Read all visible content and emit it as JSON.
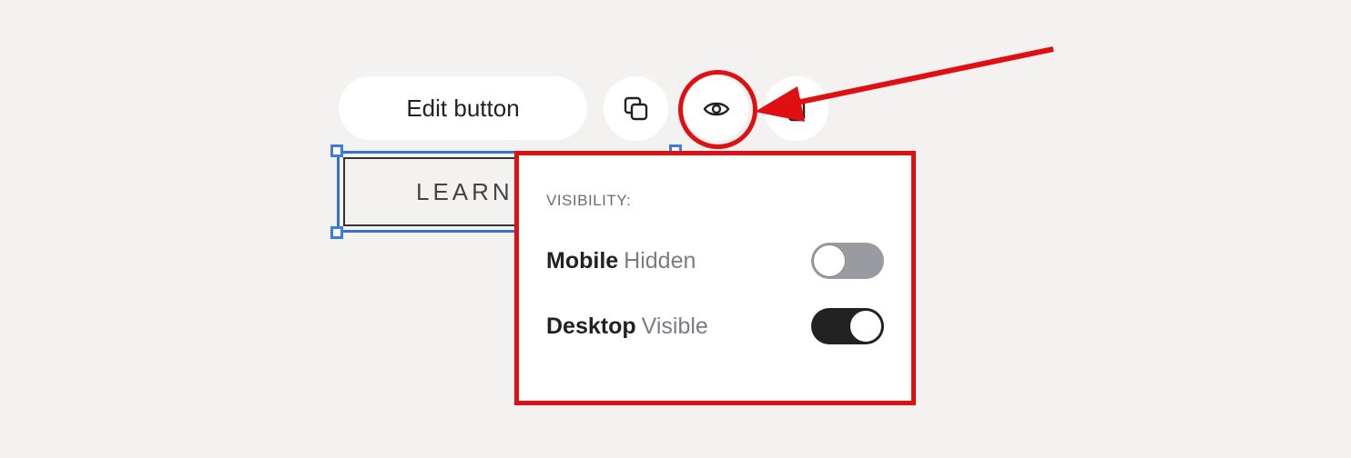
{
  "toolbar": {
    "edit_label": "Edit button",
    "icons": {
      "copy": "duplicate-icon",
      "visibility": "eye-icon",
      "delete": "trash-icon"
    }
  },
  "element": {
    "label": "LEARN"
  },
  "visibility_panel": {
    "heading": "VISIBILITY:",
    "rows": [
      {
        "device": "Mobile",
        "state": "Hidden",
        "enabled": false
      },
      {
        "device": "Desktop",
        "state": "Visible",
        "enabled": true
      }
    ]
  },
  "annotation": {
    "color": "#e00f12"
  }
}
